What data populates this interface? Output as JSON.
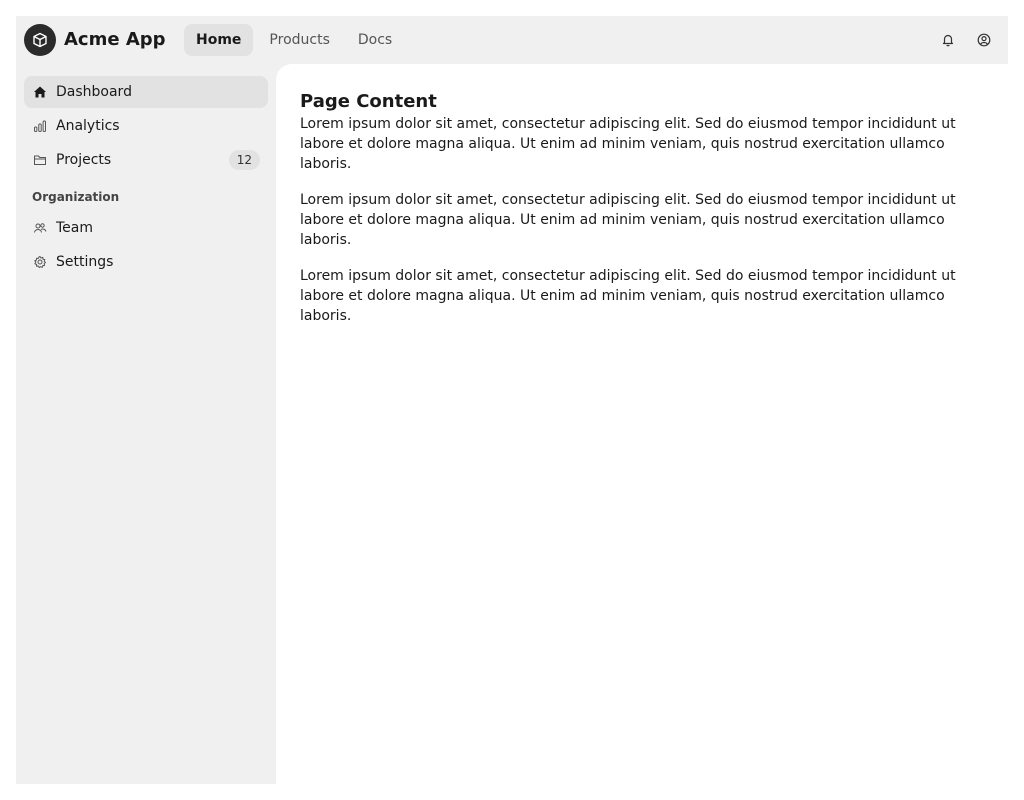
{
  "app": {
    "name": "Acme App",
    "logo_icon": "cube-icon"
  },
  "nav": {
    "items": [
      {
        "label": "Home",
        "active": true
      },
      {
        "label": "Products",
        "active": false
      },
      {
        "label": "Docs",
        "active": false
      }
    ]
  },
  "top_icons": {
    "notifications": "bell-icon",
    "profile": "user-circle-icon"
  },
  "sidebar": {
    "items": [
      {
        "label": "Dashboard",
        "icon": "home-icon",
        "active": true
      },
      {
        "label": "Analytics",
        "icon": "bar-chart-icon",
        "active": false
      },
      {
        "label": "Projects",
        "icon": "folder-icon",
        "active": false,
        "badge": "12"
      }
    ],
    "section_label": "Organization",
    "org_items": [
      {
        "label": "Team",
        "icon": "users-icon"
      },
      {
        "label": "Settings",
        "icon": "gear-icon"
      }
    ]
  },
  "main": {
    "title": "Page Content",
    "paragraphs": [
      "Lorem ipsum dolor sit amet, consectetur adipiscing elit. Sed do eiusmod tempor incididunt ut labore et dolore magna aliqua. Ut enim ad minim veniam, quis nostrud exercitation ullamco laboris.",
      "Lorem ipsum dolor sit amet, consectetur adipiscing elit. Sed do eiusmod tempor incididunt ut labore et dolore magna aliqua. Ut enim ad minim veniam, quis nostrud exercitation ullamco laboris.",
      "Lorem ipsum dolor sit amet, consectetur adipiscing elit. Sed do eiusmod tempor incididunt ut labore et dolore magna aliqua. Ut enim ad minim veniam, quis nostrud exercitation ullamco laboris."
    ]
  },
  "colors": {
    "frame_bg": "#f0f0f0",
    "active_bg": "#e2e2e2",
    "logo_bg": "#2b2b2b",
    "content_bg": "#ffffff"
  }
}
